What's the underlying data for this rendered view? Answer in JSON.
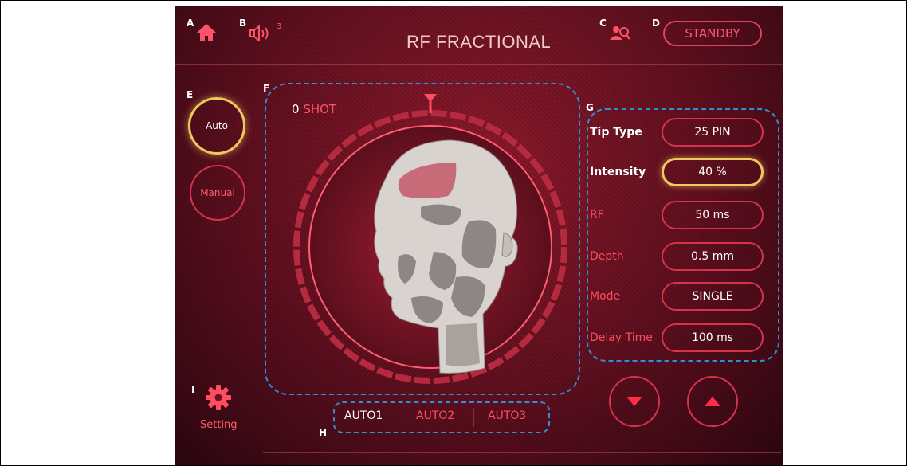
{
  "letters": {
    "a": "A",
    "b": "B",
    "c": "C",
    "d": "D",
    "e": "E",
    "f": "F",
    "g": "G",
    "h": "H",
    "i": "I"
  },
  "header": {
    "title": "RF FRACTIONAL",
    "volume_level": "3",
    "status": "STANDBY"
  },
  "modes": {
    "auto": "Auto",
    "manual": "Manual"
  },
  "shot": {
    "count": "0",
    "label": "SHOT"
  },
  "params": [
    {
      "label": "Tip Type",
      "value": "25 PIN"
    },
    {
      "label": "Intensity",
      "value": "40 %"
    },
    {
      "label": "RF",
      "value": "50 ms"
    },
    {
      "label": "Depth",
      "value": "0.5 mm"
    },
    {
      "label": "Mode",
      "value": "SINGLE"
    },
    {
      "label": "Delay Time",
      "value": "100 ms"
    }
  ],
  "presets": [
    "AUTO1",
    "AUTO2",
    "AUTO3"
  ],
  "setting": {
    "label": "Setting"
  },
  "colors": {
    "accent": "#e0435a",
    "highlight": "#f5d26a",
    "annotation": "#2f8fd6",
    "background": "#5e0f1e"
  },
  "icons": {
    "home": "home-icon",
    "volume": "speaker-icon",
    "search": "search-user-icon",
    "gear": "gear-icon",
    "down": "triangle-down-icon",
    "up": "triangle-up-icon"
  }
}
